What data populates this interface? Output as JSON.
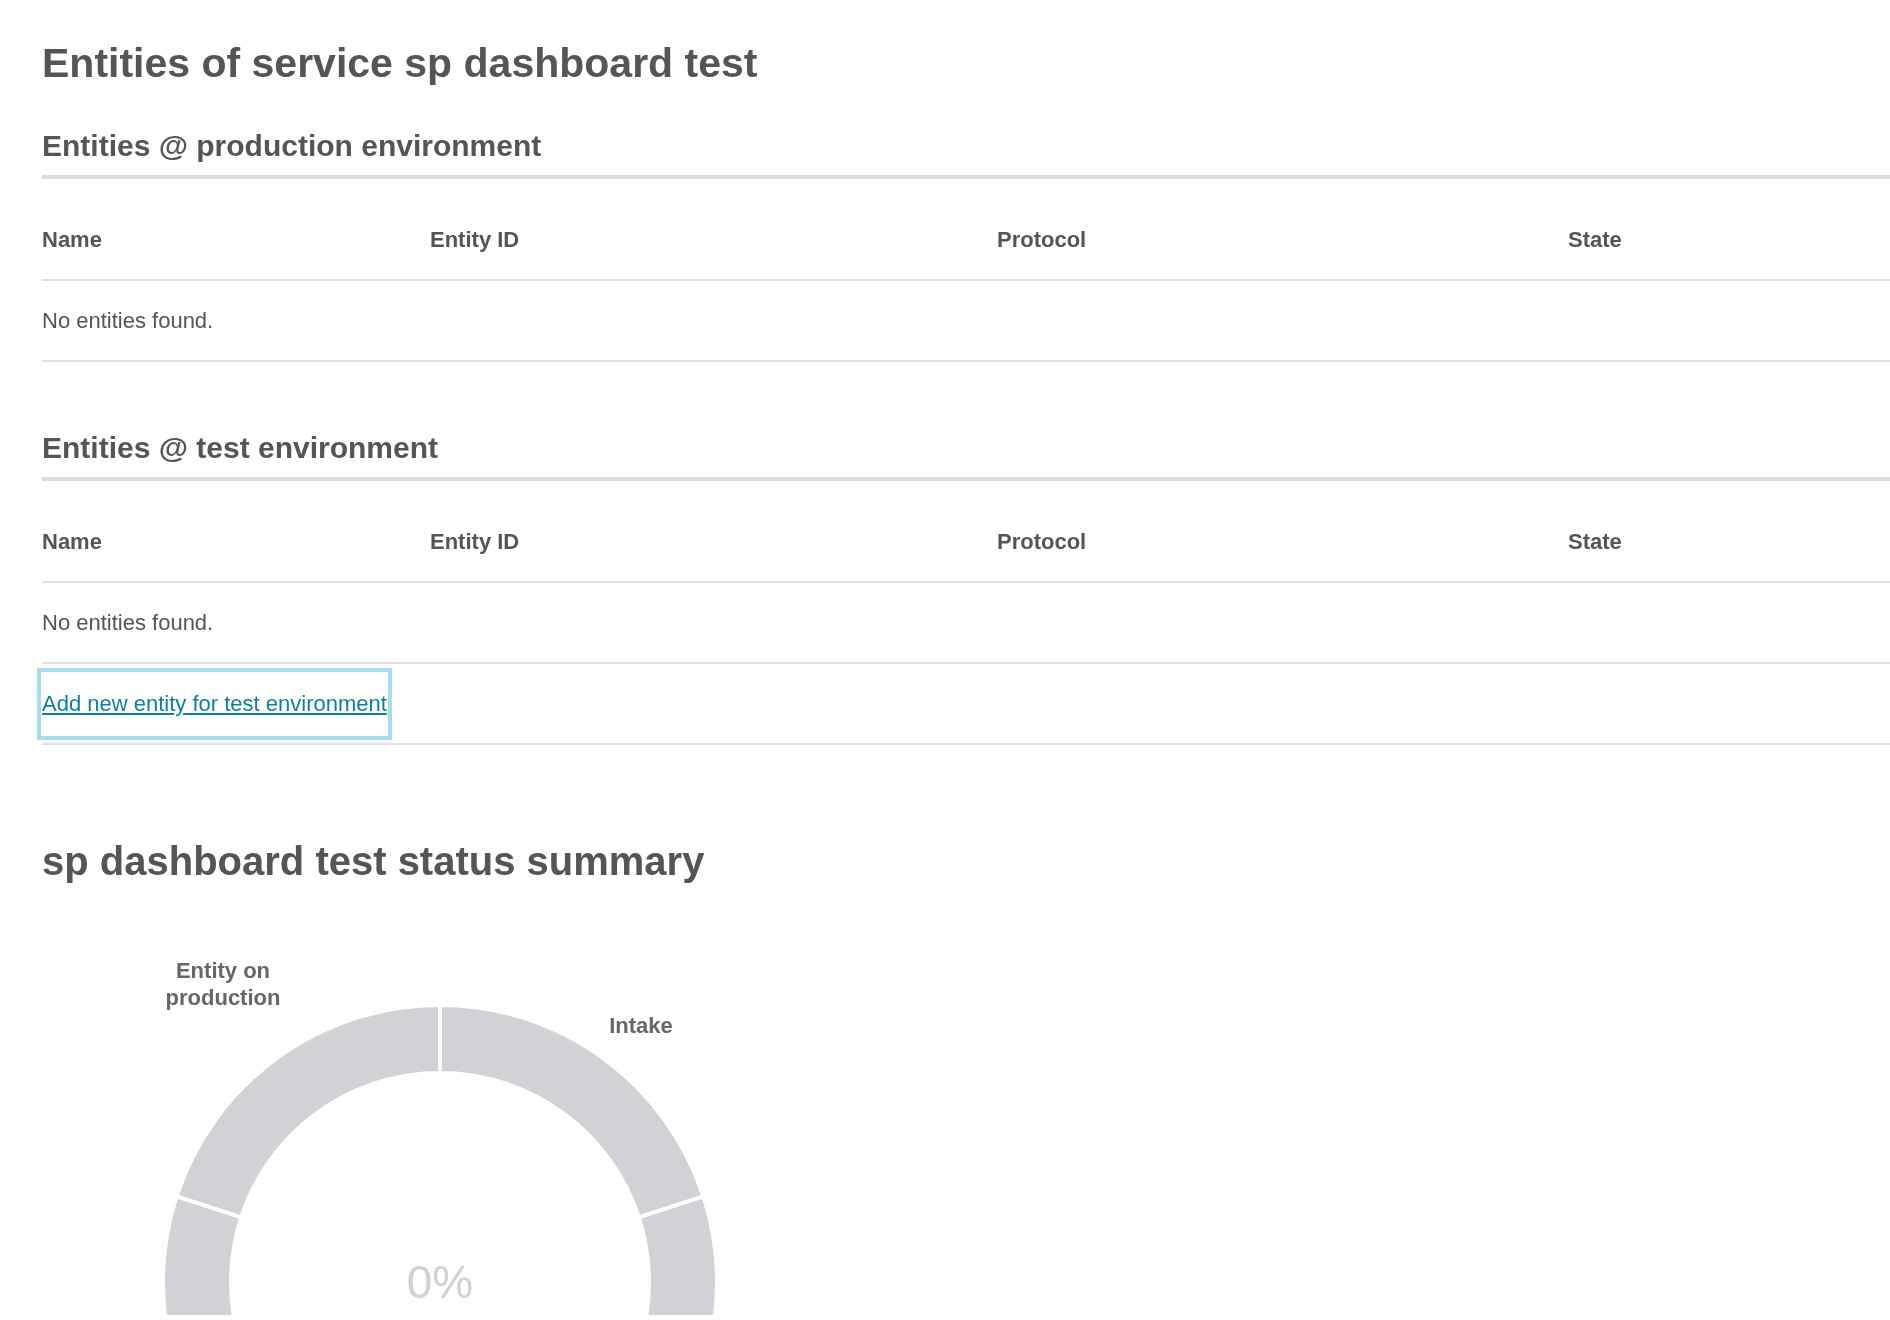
{
  "title": "Entities of service sp dashboard test",
  "sections": [
    {
      "heading": "Entities @ production environment",
      "columns": [
        "Name",
        "Entity ID",
        "Protocol",
        "State"
      ],
      "empty_message": "No entities found."
    },
    {
      "heading": "Entities @ test environment",
      "columns": [
        "Name",
        "Entity ID",
        "Protocol",
        "State"
      ],
      "empty_message": "No entities found.",
      "add_link": "Add new entity for test environment"
    }
  ],
  "summary": {
    "heading": "sp dashboard test status summary",
    "segment_labels": [
      "Entity on production",
      "Intake"
    ],
    "center_label": "0%"
  }
}
